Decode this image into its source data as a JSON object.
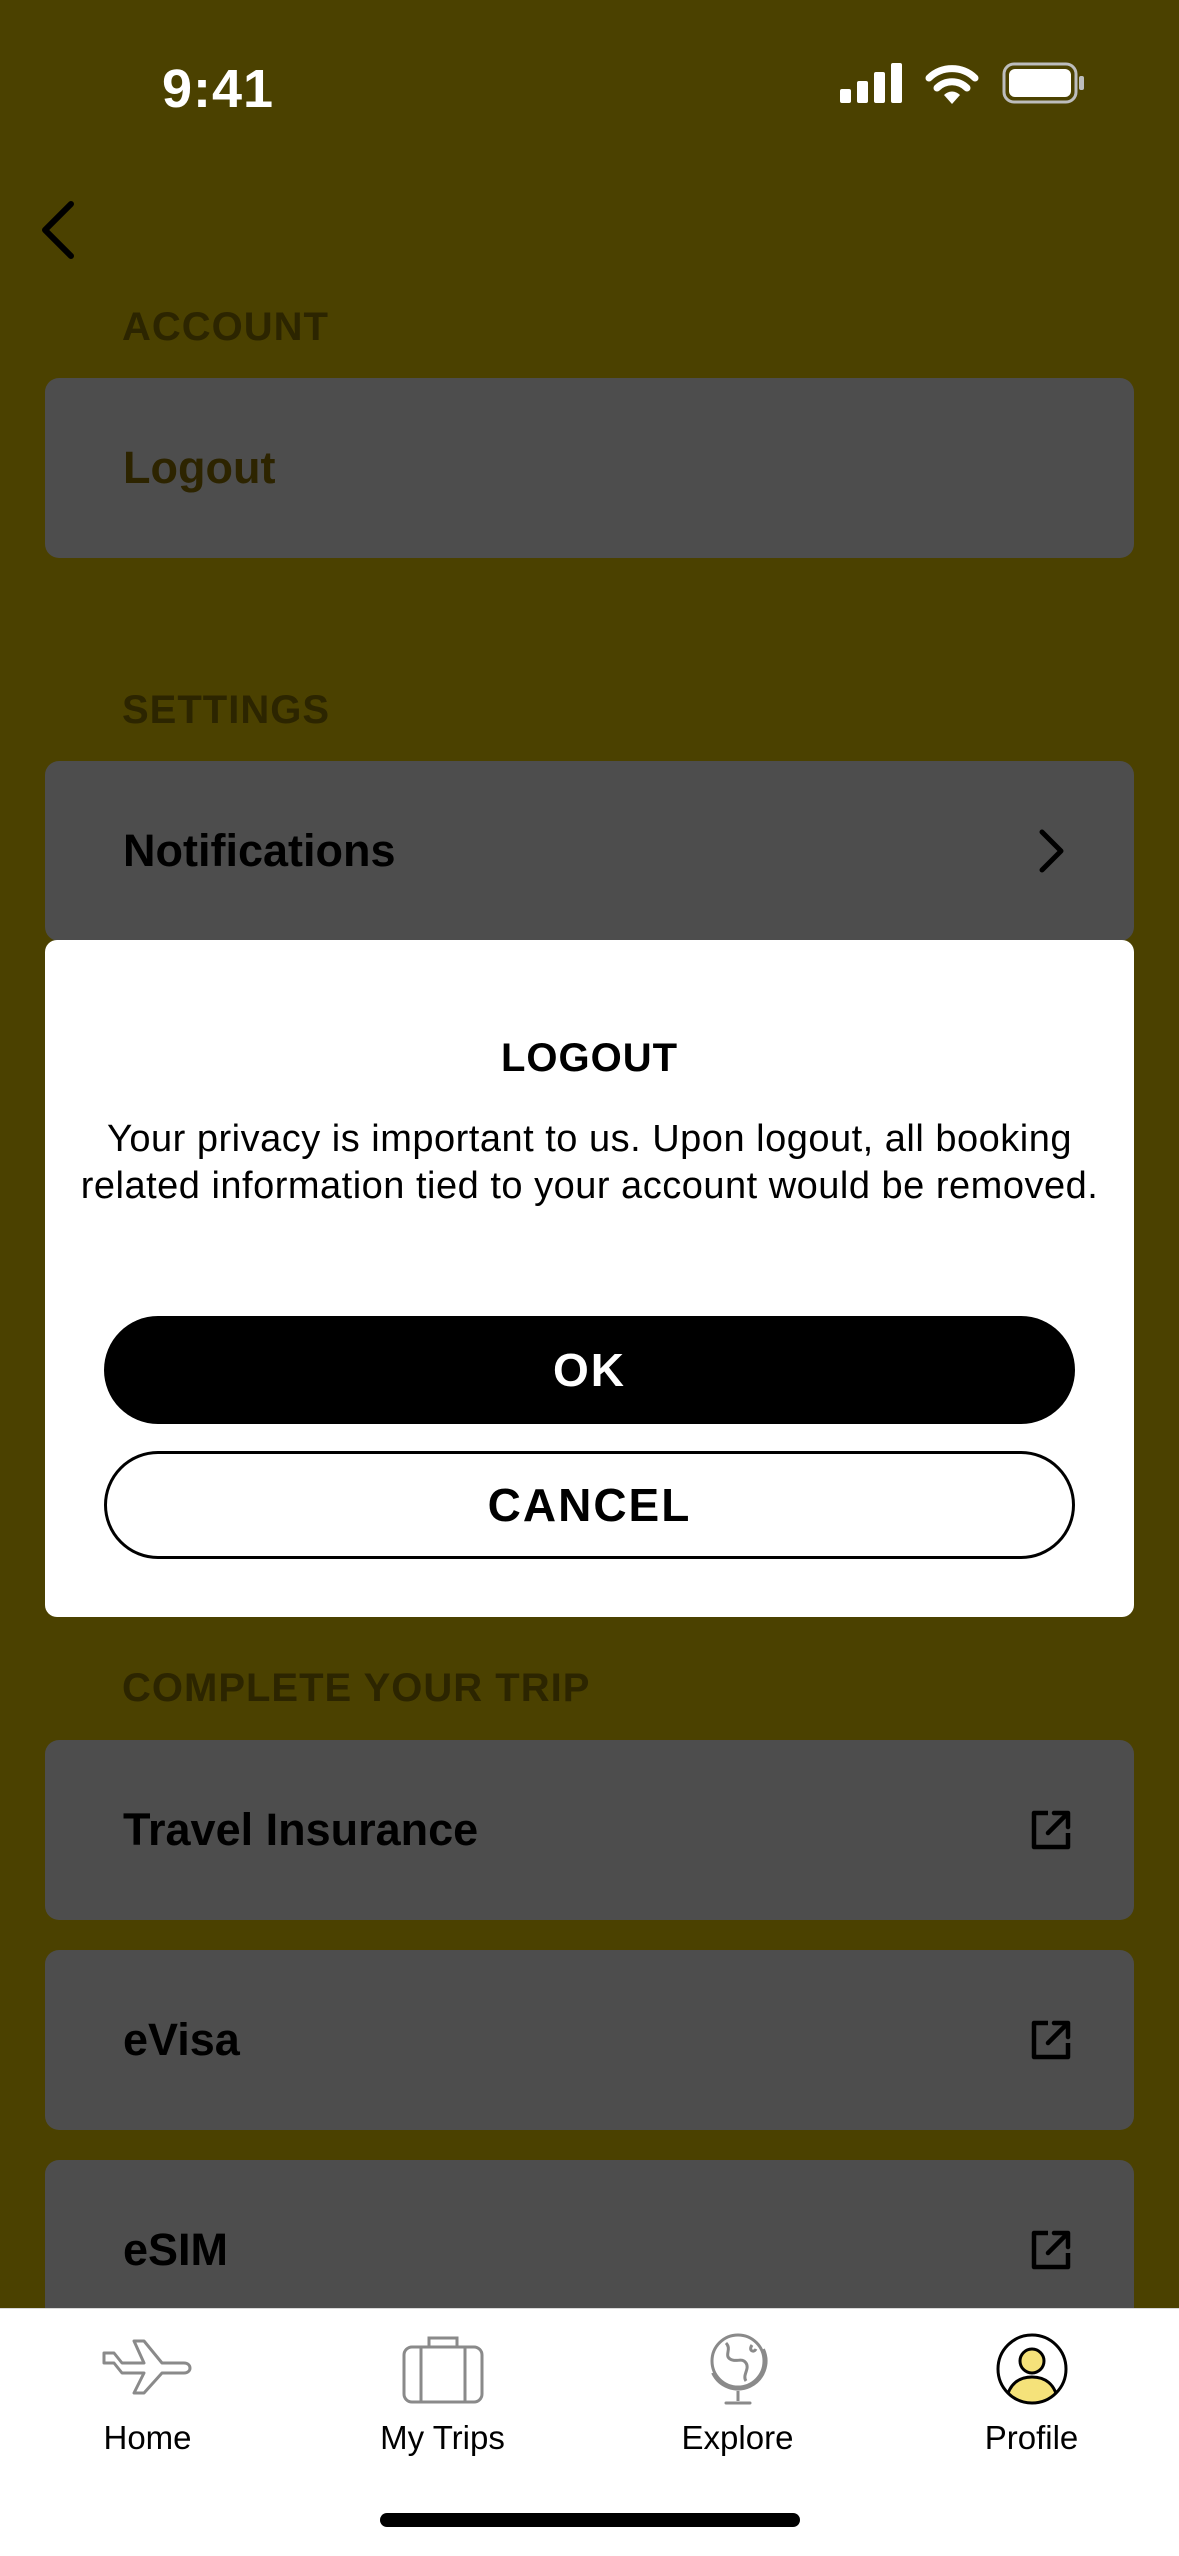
{
  "status_bar": {
    "time": "9:41"
  },
  "sections": {
    "account": {
      "title": "ACCOUNT",
      "items": [
        "Logout"
      ]
    },
    "settings": {
      "title": "SETTINGS",
      "items": [
        "Notifications"
      ]
    },
    "complete_trip": {
      "title": "COMPLETE YOUR TRIP",
      "items": [
        "Travel Insurance",
        "eVisa",
        "eSIM"
      ]
    }
  },
  "modal": {
    "title": "LOGOUT",
    "message": "Your privacy is important to us. Upon logout, all booking related information tied to your account would be removed.",
    "ok_label": "OK",
    "cancel_label": "CANCEL"
  },
  "tab_bar": {
    "items": [
      {
        "label": "Home",
        "icon": "airplane-icon"
      },
      {
        "label": "My Trips",
        "icon": "suitcase-icon"
      },
      {
        "label": "Explore",
        "icon": "globe-icon"
      },
      {
        "label": "Profile",
        "icon": "profile-icon"
      }
    ],
    "active": "Profile"
  },
  "colors": {
    "overlay_bg": "#4b4100",
    "card_bg": "#4d4d4d",
    "accent_yellow": "#f5e27a"
  }
}
